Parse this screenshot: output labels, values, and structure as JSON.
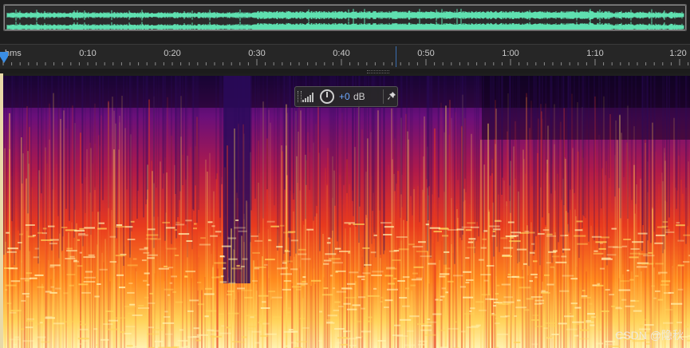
{
  "overview": {
    "waveform_color": "#5fe0b0",
    "background_color": "#2b2b2b"
  },
  "ruler": {
    "units_label": "hms",
    "ticks": [
      "0:10",
      "0:20",
      "0:30",
      "0:40",
      "0:50",
      "1:00",
      "1:10",
      "1:20"
    ],
    "playhead_color": "#3a8ee6"
  },
  "spectrogram": {
    "palette": [
      "#0a0014",
      "#2a0a5a",
      "#6a0f7a",
      "#b01a4a",
      "#e83a1e",
      "#ff8a1e",
      "#ffd35a",
      "#fff2b0"
    ],
    "quiet_gap_time": "0:29"
  },
  "hud": {
    "gain_value": "+0",
    "gain_unit": "dB",
    "level_icon": "signal-bars-icon",
    "knob_icon": "volume-knob-icon",
    "pin_icon": "pin-icon"
  },
  "watermark": {
    "text": "CSDN @隐秋"
  }
}
